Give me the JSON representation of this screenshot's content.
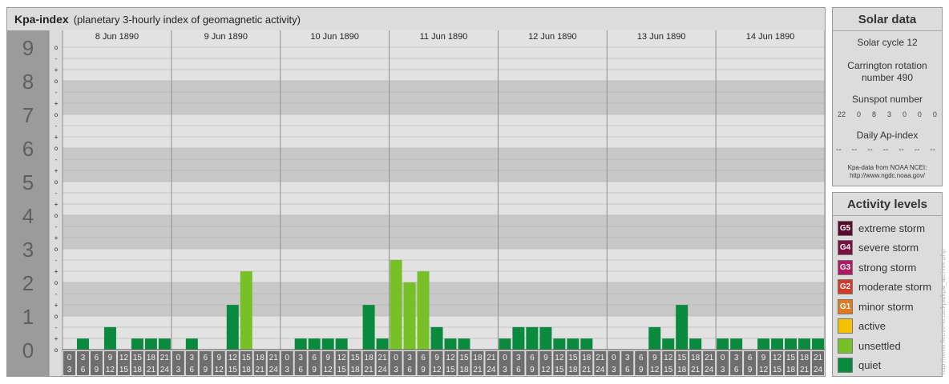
{
  "header": {
    "title": "Kpa-index",
    "subtitle": "(planetary 3-hourly index of geomagnetic activity)"
  },
  "chart_data": {
    "type": "bar",
    "title": "Kpa-index",
    "subtitle": "(planetary 3-hourly index of geomagnetic activity)",
    "ylim": [
      0,
      9
    ],
    "y_ticks": [
      "0",
      "1",
      "2",
      "3",
      "4",
      "5",
      "6",
      "7",
      "8",
      "9"
    ],
    "y_subticks": [
      "-",
      "o",
      "+"
    ],
    "days": [
      "8 Jun 1890",
      "9 Jun 1890",
      "10 Jun 1890",
      "11 Jun 1890",
      "12 Jun 1890",
      "13 Jun 1890",
      "14 Jun 1890"
    ],
    "interval_start_labels": [
      "0",
      "3",
      "6",
      "9",
      "12",
      "15",
      "18",
      "21"
    ],
    "interval_end_labels": [
      "3",
      "6",
      "9",
      "12",
      "15",
      "18",
      "21",
      "24"
    ],
    "series": [
      {
        "values": [
          [
            0,
            0.33,
            0,
            0.67,
            0,
            0.33,
            0.33,
            0.33
          ],
          [
            0,
            0.33,
            0,
            0,
            1.33,
            2.33,
            0,
            0
          ],
          [
            0,
            0.33,
            0.33,
            0.33,
            0.33,
            0,
            1.33,
            0.33
          ],
          [
            2.67,
            2,
            2.33,
            0.67,
            0.33,
            0.33,
            0,
            0
          ],
          [
            0.33,
            0.67,
            0.67,
            0.67,
            0.33,
            0.33,
            0.33,
            0
          ],
          [
            0,
            0,
            0,
            0.67,
            0.33,
            1.33,
            0.33,
            0
          ],
          [
            0.33,
            0.33,
            0,
            0.33,
            0.33,
            0.33,
            0.33,
            0.33
          ]
        ]
      }
    ],
    "color_thresholds": [
      {
        "min": 9,
        "color": "#5a0a2a"
      },
      {
        "min": 8,
        "color": "#7a1040"
      },
      {
        "min": 7,
        "color": "#b01860"
      },
      {
        "min": 6,
        "color": "#d43a2a"
      },
      {
        "min": 5,
        "color": "#e07a20"
      },
      {
        "min": 4,
        "color": "#f4c000"
      },
      {
        "min": 2,
        "color": "#78c028"
      },
      {
        "min": 0,
        "color": "#0a8a3e"
      }
    ]
  },
  "solar": {
    "title": "Solar data",
    "cycle": "Solar cycle 12",
    "carrington_line1": "Carrington rotation",
    "carrington_line2": "number 490",
    "sunspot_label": "Sunspot number",
    "sunspot_values": [
      "22",
      "0",
      "8",
      "3",
      "0",
      "0",
      "0"
    ],
    "ap_label": "Daily Ap-index",
    "ap_values": [
      "--",
      "--",
      "--",
      "--",
      "--",
      "--",
      "--"
    ],
    "source_line1": "Kpa-data from NOAA NCEI:",
    "source_line2": "http://www.ngdc.noaa.gov/"
  },
  "activity": {
    "title": "Activity levels",
    "levels": [
      {
        "code": "G5",
        "label": "extreme storm",
        "color": "#5a0a2a"
      },
      {
        "code": "G4",
        "label": "severe storm",
        "color": "#7a1040"
      },
      {
        "code": "G3",
        "label": "strong storm",
        "color": "#b01860"
      },
      {
        "code": "G2",
        "label": "moderate storm",
        "color": "#d43a2a"
      },
      {
        "code": "G1",
        "label": "minor storm",
        "color": "#e07a20"
      },
      {
        "code": "",
        "label": "active",
        "color": "#f4c000"
      },
      {
        "code": "",
        "label": "unsettled",
        "color": "#78c028"
      },
      {
        "code": "",
        "label": "quiet",
        "color": "#0a8a3e"
      }
    ]
  },
  "watermark": "http://www.fleuve-kr.de/kpa/kpa_archive.php"
}
